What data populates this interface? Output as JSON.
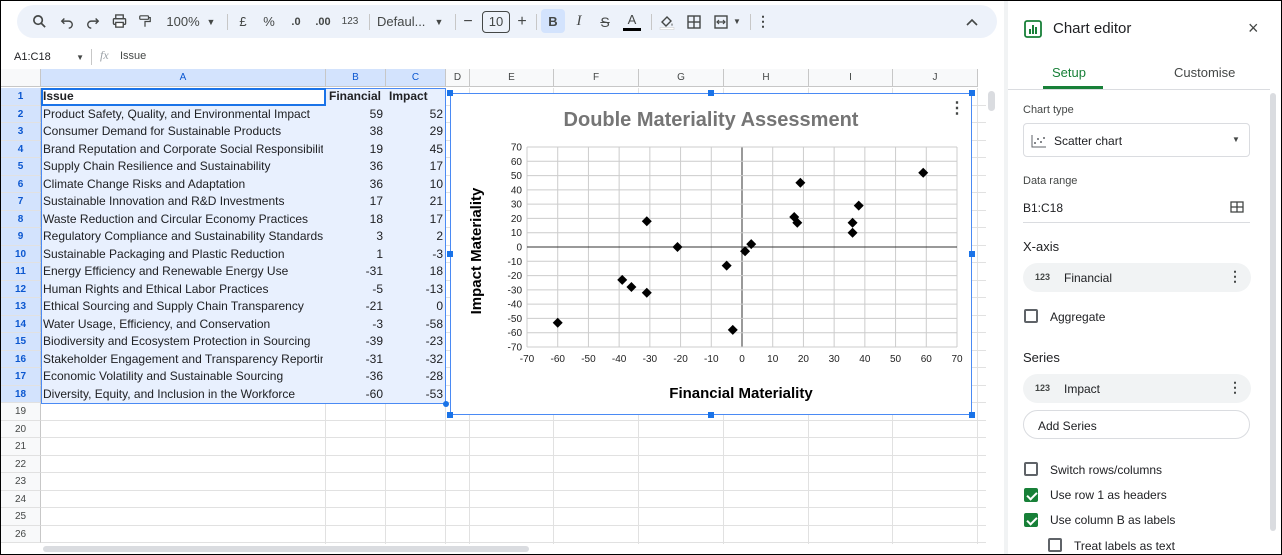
{
  "toolbar": {
    "zoom": "100%",
    "currency": "£",
    "percent": "%",
    "dec_less": ".0",
    "dec_more": ".00",
    "format_123": "123",
    "font": "Defaul...",
    "font_size": "10",
    "bold": "B",
    "italic": "I",
    "text_color": "A"
  },
  "formula_bar": {
    "name_box": "A1:C18",
    "fx": "fx",
    "value": "Issue"
  },
  "columns": [
    "A",
    "B",
    "C",
    "D",
    "E",
    "F",
    "G",
    "H",
    "I",
    "J"
  ],
  "rows": [
    "1",
    "2",
    "3",
    "4",
    "5",
    "6",
    "7",
    "8",
    "9",
    "10",
    "11",
    "12",
    "13",
    "14",
    "15",
    "16",
    "17",
    "18",
    "19",
    "20",
    "21",
    "22",
    "23",
    "24",
    "25",
    "26"
  ],
  "table": {
    "headers": [
      "Issue",
      "Financial",
      "Impact"
    ],
    "rows": [
      [
        "Product Safety, Quality, and Environmental Impact",
        "59",
        "52"
      ],
      [
        "Consumer Demand for Sustainable Products",
        "38",
        "29"
      ],
      [
        "Brand Reputation and Corporate Social Responsibility",
        "19",
        "45"
      ],
      [
        "Supply Chain Resilience and Sustainability",
        "36",
        "17"
      ],
      [
        "Climate Change Risks and Adaptation",
        "36",
        "10"
      ],
      [
        "Sustainable Innovation and R&D Investments",
        "17",
        "21"
      ],
      [
        "Waste Reduction and Circular Economy Practices",
        "18",
        "17"
      ],
      [
        "Regulatory Compliance and Sustainability Standards",
        "3",
        "2"
      ],
      [
        "Sustainable Packaging and Plastic Reduction",
        "1",
        "-3"
      ],
      [
        "Energy Efficiency and Renewable Energy Use",
        "-31",
        "18"
      ],
      [
        "Human Rights and Ethical Labor Practices",
        "-5",
        "-13"
      ],
      [
        "Ethical Sourcing and Supply Chain Transparency",
        "-21",
        "0"
      ],
      [
        "Water Usage, Efficiency, and Conservation",
        "-3",
        "-58"
      ],
      [
        "Biodiversity and Ecosystem Protection in Sourcing",
        "-39",
        "-23"
      ],
      [
        "Stakeholder Engagement and Transparency Reporting",
        "-31",
        "-32"
      ],
      [
        "Economic Volatility and Sustainable Sourcing",
        "-36",
        "-28"
      ],
      [
        "Diversity, Equity, and Inclusion in the Workforce",
        "-60",
        "-53"
      ]
    ]
  },
  "chart_data": {
    "type": "scatter",
    "title": "Double Materiality Assessment",
    "xlabel": "Financial Materiality",
    "ylabel": "Impact Materiality",
    "xlim": [
      -70,
      70
    ],
    "ylim": [
      -70,
      70
    ],
    "x_ticks": [
      "-70",
      "-60",
      "-50",
      "-40",
      "-30",
      "-20",
      "-10",
      "0",
      "10",
      "20",
      "30",
      "40",
      "50",
      "60",
      "70"
    ],
    "y_ticks": [
      "70",
      "60",
      "50",
      "40",
      "30",
      "20",
      "10",
      "0",
      "-10",
      "-20",
      "-30",
      "-40",
      "-50",
      "-60",
      "-70"
    ],
    "grid": true,
    "series": [
      {
        "points": [
          [
            59,
            52
          ],
          [
            38,
            29
          ],
          [
            19,
            45
          ],
          [
            36,
            17
          ],
          [
            36,
            10
          ],
          [
            17,
            21
          ],
          [
            18,
            17
          ],
          [
            3,
            2
          ],
          [
            1,
            -3
          ],
          [
            -31,
            18
          ],
          [
            -5,
            -13
          ],
          [
            -21,
            0
          ],
          [
            -3,
            -58
          ],
          [
            -39,
            -23
          ],
          [
            -31,
            -32
          ],
          [
            -36,
            -28
          ],
          [
            -60,
            -53
          ]
        ]
      }
    ]
  },
  "sidebar": {
    "title": "Chart editor",
    "tab_setup": "Setup",
    "tab_customise": "Customise",
    "chart_type_label": "Chart type",
    "chart_type_value": "Scatter chart",
    "data_range_label": "Data range",
    "data_range_value": "B1:C18",
    "xaxis_label": "X-axis",
    "xaxis_badge": "123",
    "xaxis_value": "Financial",
    "aggregate_label": "Aggregate",
    "series_label": "Series",
    "series_badge": "123",
    "series_value": "Impact",
    "add_series": "Add Series",
    "switch_rows": "Switch rows/columns",
    "use_row1": "Use row 1 as headers",
    "use_colb": "Use column B as labels",
    "treat_labels": "Treat labels as text"
  }
}
